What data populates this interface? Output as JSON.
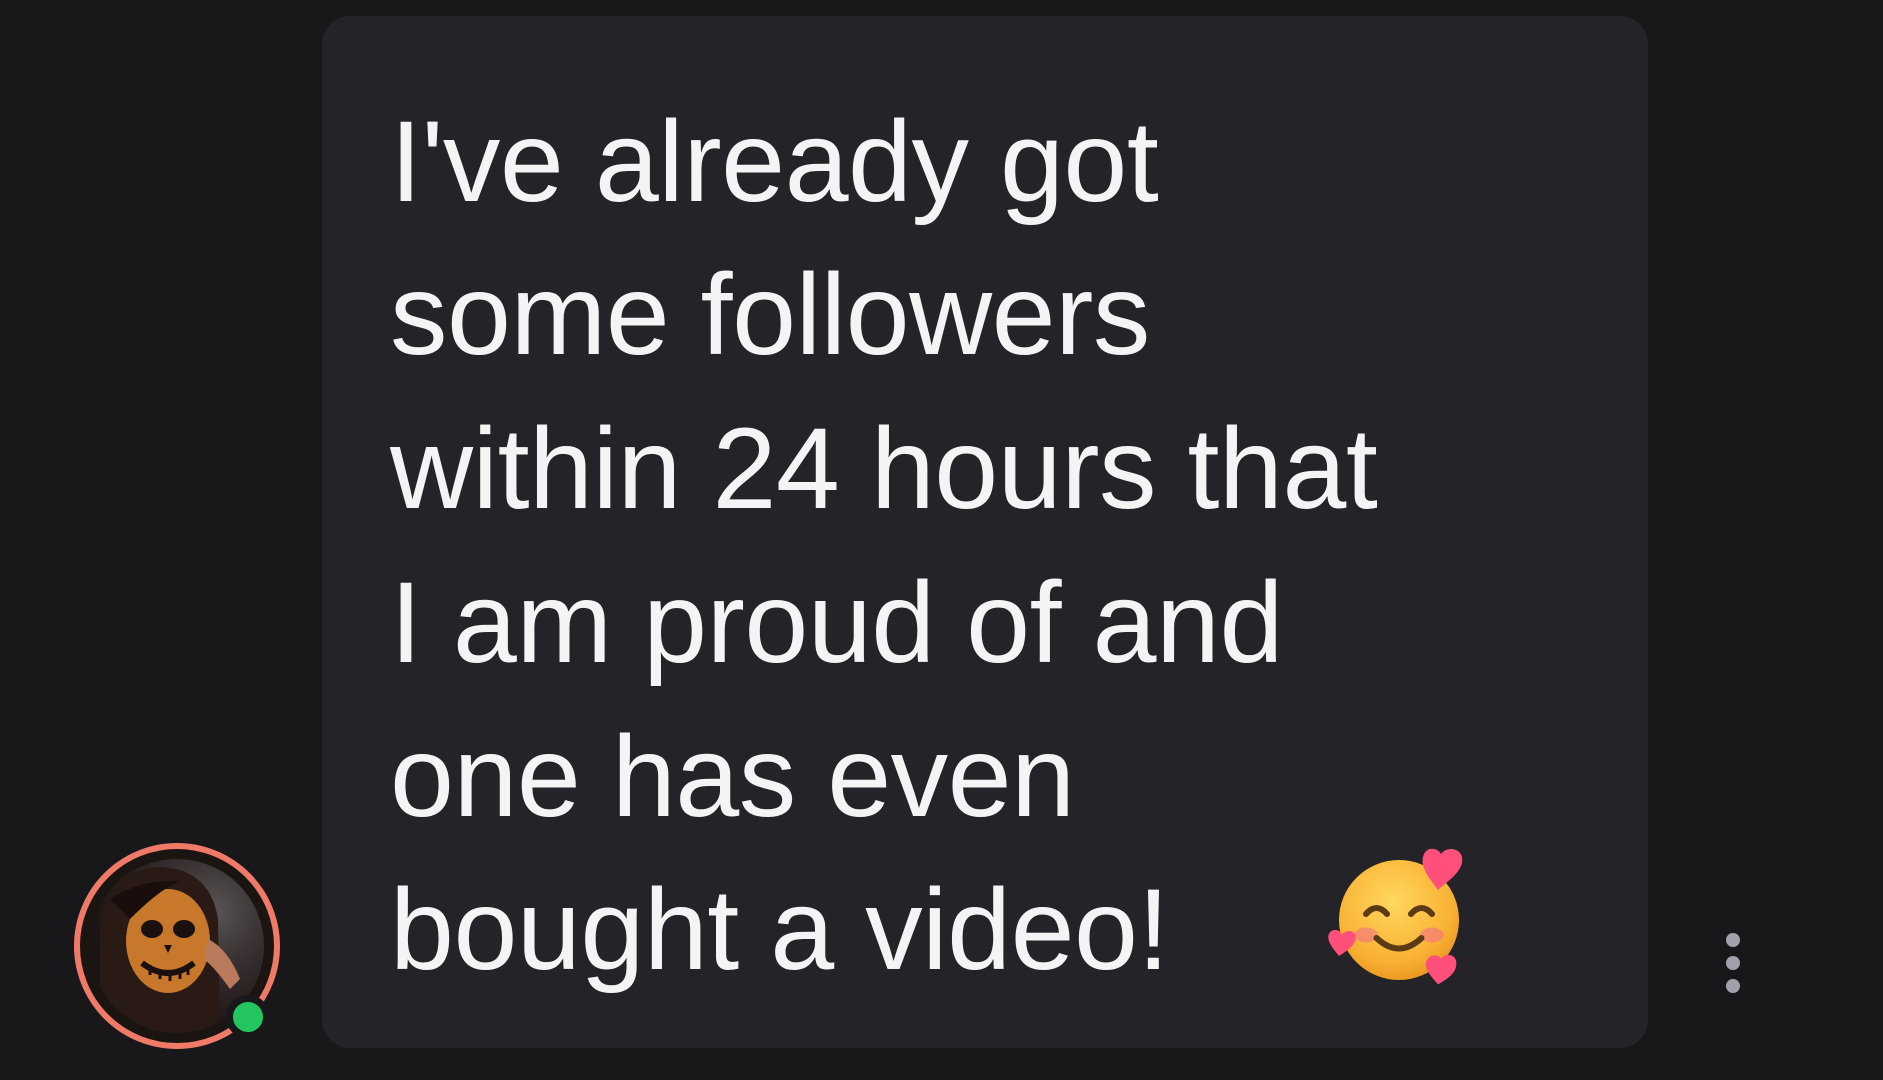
{
  "message": {
    "lines": [
      "I've already got",
      "some followers",
      "within 24 hours that",
      "I am proud of and",
      "one has even",
      "bought a video!"
    ],
    "emoji": "smiling-face-with-hearts",
    "online_status": "online"
  },
  "colors": {
    "background": "#18181b",
    "bubble": "#232328",
    "text": "#f4f4f5",
    "avatar_ring": "#ef7a68",
    "online_dot": "#22c55e"
  },
  "icons": {
    "more": "more-vertical-icon"
  }
}
